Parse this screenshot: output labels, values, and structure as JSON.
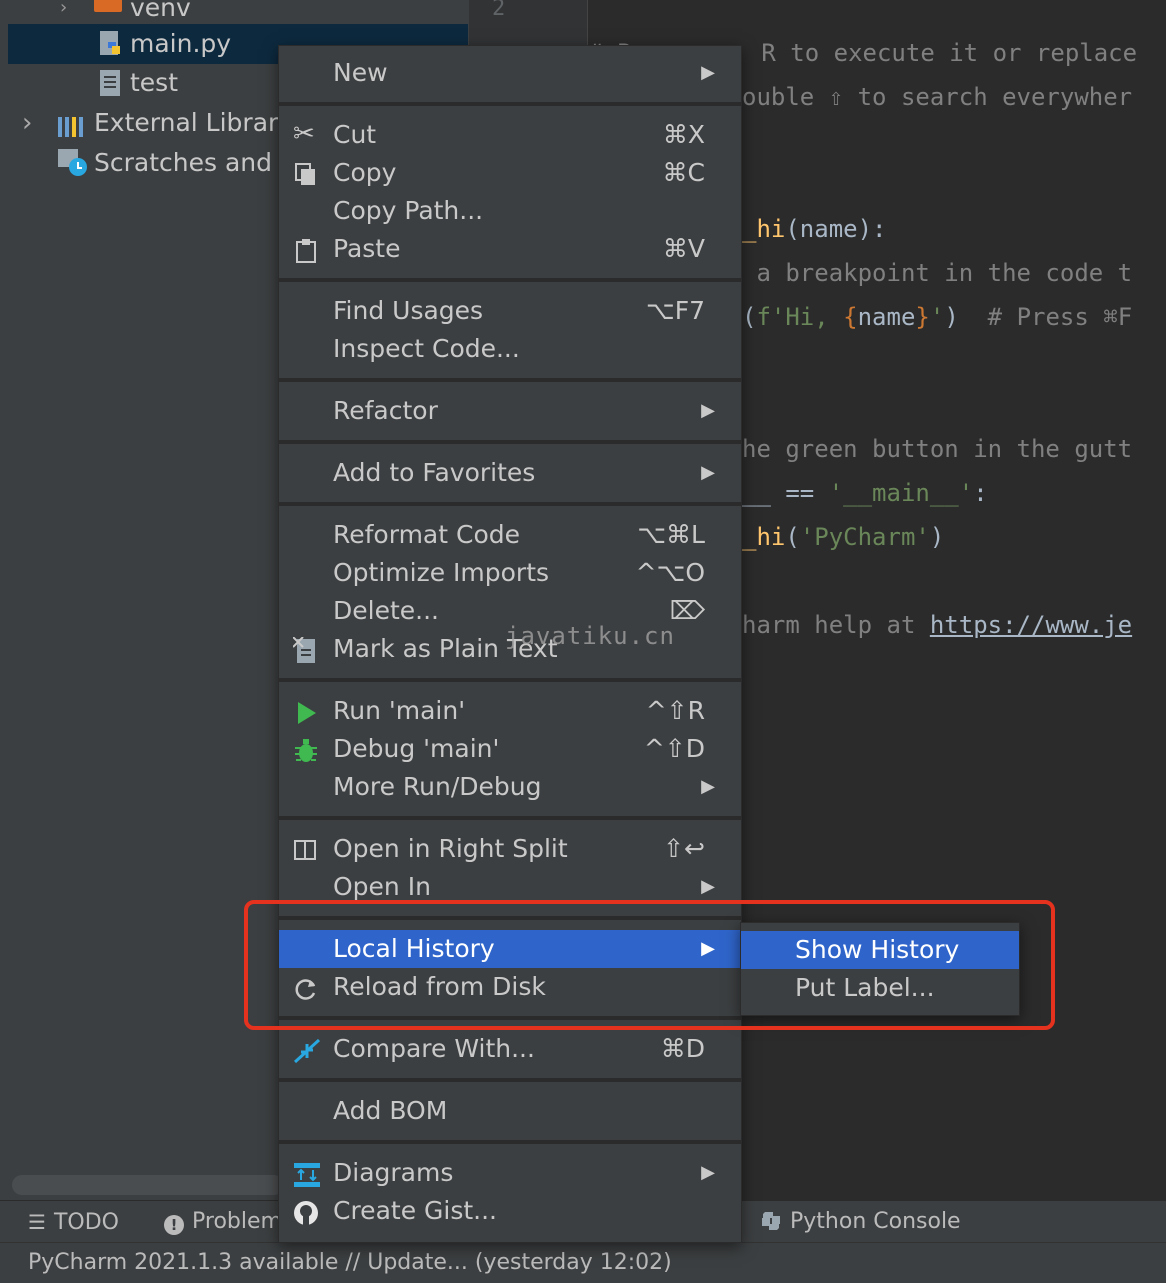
{
  "project": {
    "items": [
      {
        "label": "venv",
        "icon": "folder-icon"
      },
      {
        "label": "main.py",
        "icon": "python-file-icon"
      },
      {
        "label": "test",
        "icon": "text-file-icon"
      },
      {
        "label": "External Librari",
        "icon": "library-icon"
      },
      {
        "label": "Scratches and",
        "icon": "scratches-icon"
      }
    ]
  },
  "editor": {
    "line_number": "2",
    "lines": {
      "l1": "# P         R to execute it or replace",
      "l2": "ouble ⇧ to search everywher",
      "l3_fn": "_hi",
      "l3_rest": "(name):",
      "l4": " a breakpoint in the code t",
      "l5_a": "(",
      "l5_str1": "f'Hi, ",
      "l5_b1": "{",
      "l5_name": "name",
      "l5_b2": "}",
      "l5_str2": "'",
      "l5_c": ")  ",
      "l5_cmt": "# Press ⌘F",
      "l6": "he green button in the gutt",
      "l7_a": "__ == ",
      "l7_str": "'__main__'",
      "l7_b": ":",
      "l8_fn": "_hi",
      "l8_a": "(",
      "l8_str": "'PyCharm'",
      "l8_b": ")",
      "l9_a": "harm help at ",
      "l9_link": "https://www.je"
    }
  },
  "menu": {
    "new": {
      "label": "New"
    },
    "cut": {
      "label": "Cut",
      "shortcut": "⌘X"
    },
    "copy": {
      "label": "Copy",
      "shortcut": "⌘C"
    },
    "copy_path": {
      "label": "Copy Path..."
    },
    "paste": {
      "label": "Paste",
      "shortcut": "⌘V"
    },
    "find_usages": {
      "label": "Find Usages",
      "shortcut": "⌥F7"
    },
    "inspect_code": {
      "label": "Inspect Code..."
    },
    "refactor": {
      "label": "Refactor"
    },
    "add_to_favorites": {
      "label": "Add to Favorites"
    },
    "reformat_code": {
      "label": "Reformat Code",
      "shortcut": "⌥⌘L"
    },
    "optimize_imports": {
      "label": "Optimize Imports",
      "shortcut": "^⌥O"
    },
    "delete": {
      "label": "Delete...",
      "shortcut": "⌦"
    },
    "mark_plain_text": {
      "label": "Mark as Plain Text"
    },
    "run_main": {
      "label": "Run 'main'",
      "shortcut": "^⇧R"
    },
    "debug_main": {
      "label": "Debug 'main'",
      "shortcut": "^⇧D"
    },
    "more_run_debug": {
      "label": "More Run/Debug"
    },
    "open_right_split": {
      "label": "Open in Right Split",
      "shortcut": "⇧↩"
    },
    "open_in": {
      "label": "Open In"
    },
    "local_history": {
      "label": "Local History"
    },
    "reload_from_disk": {
      "label": "Reload from Disk"
    },
    "compare_with": {
      "label": "Compare With...",
      "shortcut": "⌘D"
    },
    "add_bom": {
      "label": "Add BOM"
    },
    "diagrams": {
      "label": "Diagrams"
    },
    "create_gist": {
      "label": "Create Gist..."
    }
  },
  "submenu": {
    "show_history": "Show History",
    "put_label": "Put Label..."
  },
  "toolbar": {
    "todo": "TODO",
    "problems": "Problem",
    "python_console": "Python Console"
  },
  "status": "PyCharm 2021.1.3 available // Update... (yesterday 12:02)",
  "watermark": "javatiku.cn",
  "colors": {
    "selection": "#2f65ca",
    "highlight_box": "#e5321f",
    "run_green": "#3fb950"
  }
}
